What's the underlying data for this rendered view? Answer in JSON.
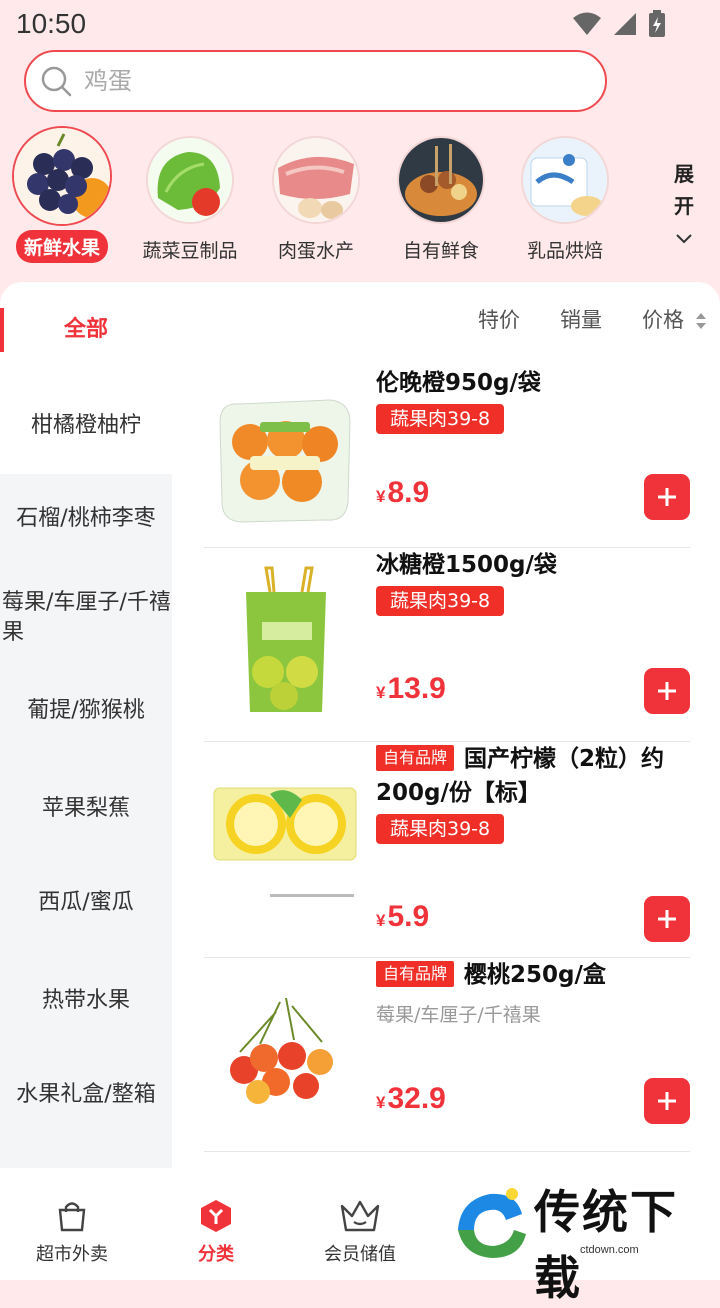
{
  "status": {
    "time": "10:50"
  },
  "search": {
    "placeholder": "鸡蛋"
  },
  "categories": [
    {
      "label": "新鲜水果",
      "icon": "fruit-image"
    },
    {
      "label": "蔬菜豆制品",
      "icon": "vegetable-image"
    },
    {
      "label": "肉蛋水产",
      "icon": "meat-egg-image"
    },
    {
      "label": "自有鲜食",
      "icon": "fresh-food-image"
    },
    {
      "label": "乳品烘焙",
      "icon": "dairy-bakery-image"
    }
  ],
  "expand": {
    "line1": "展",
    "line2": "开"
  },
  "tabs": {
    "all": "全部",
    "special": "特价",
    "sales": "销量",
    "price": "价格"
  },
  "side_nav": [
    "柑橘橙柚柠",
    "石榴/桃柿李枣",
    "莓果/车厘子/千禧果",
    "葡提/猕猴桃",
    "苹果梨蕉",
    "西瓜/蜜瓜",
    "热带水果",
    "水果礼盒/整箱"
  ],
  "products": [
    {
      "name": "伦晚橙950g/袋",
      "own_brand": "",
      "tag": "蔬果肉39-8",
      "sub": "",
      "currency": "¥",
      "price": "8.9"
    },
    {
      "name": "冰糖橙1500g/袋",
      "own_brand": "",
      "tag": "蔬果肉39-8",
      "sub": "",
      "currency": "¥",
      "price": "13.9"
    },
    {
      "name": "国产柠檬（2粒）约200g/份【标】",
      "own_brand": "自有品牌",
      "tag": "蔬果肉39-8",
      "sub": "",
      "currency": "¥",
      "price": "5.9"
    },
    {
      "name": "樱桃250g/盒",
      "own_brand": "自有品牌",
      "tag": "",
      "sub": "莓果/车厘子/千禧果",
      "currency": "¥",
      "price": "32.9"
    }
  ],
  "bottom_nav": [
    {
      "label": "超市外卖",
      "icon": "shopping-bag-icon"
    },
    {
      "label": "分类",
      "icon": "category-cube-icon"
    },
    {
      "label": "会员储值",
      "icon": "crown-icon"
    }
  ],
  "watermark": {
    "text": "传统下载",
    "sub": "ctdown.com"
  },
  "colors": {
    "accent": "#f0323a",
    "header_bg": "#ffe9ea"
  }
}
